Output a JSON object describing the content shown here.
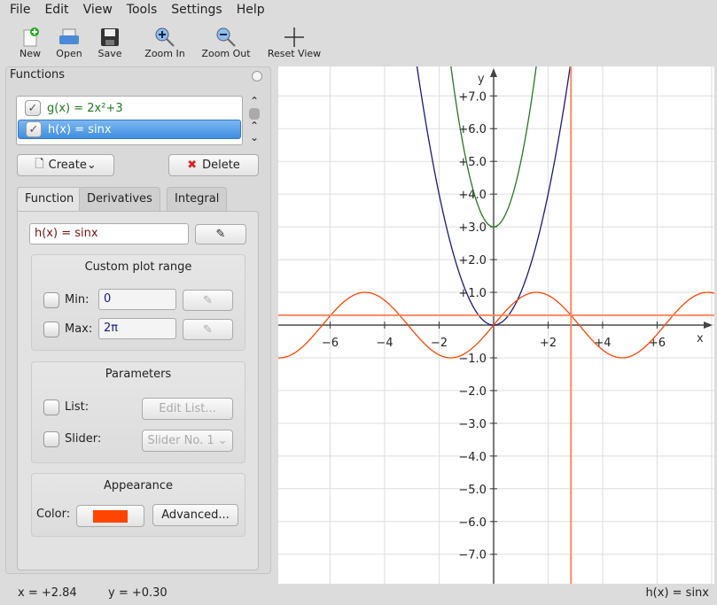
{
  "menu": [
    "File",
    "Edit",
    "View",
    "Tools",
    "Settings",
    "Help"
  ],
  "toolbar": {
    "new": "New",
    "open": "Open",
    "save": "Save",
    "zoom_in": "Zoom In",
    "zoom_out": "Zoom Out",
    "reset_view": "Reset View"
  },
  "functions_panel": {
    "title": "Functions",
    "items": [
      {
        "label": "g(x) = 2x²+3",
        "checked": true,
        "color": "#1f7a1f"
      },
      {
        "label": "h(x) = sinx",
        "checked": true,
        "selected": true
      }
    ],
    "create": "Create",
    "delete": "Delete"
  },
  "tabs": [
    "Function",
    "Derivatives",
    "Integral"
  ],
  "editor": {
    "equation_name": "h(x) = ",
    "equation_body": "sinx",
    "custom_range": {
      "title": "Custom plot range",
      "min_label": "Min:",
      "min_value": "0",
      "max_label": "Max:",
      "max_value": "2π",
      "min_checked": false,
      "max_checked": false
    },
    "parameters": {
      "title": "Parameters",
      "list_label": "List:",
      "edit_list": "Edit List...",
      "slider_label": "Slider:",
      "slider_value": "Slider No. 1"
    },
    "appearance": {
      "title": "Appearance",
      "color_label": "Color:",
      "color": "#ff4500",
      "advanced": "Advanced..."
    }
  },
  "status": {
    "x": "x = +2.84",
    "y": "y = +0.30",
    "function": "h(x) = sinx"
  },
  "plot": {
    "x_label": "x",
    "y_label": "y",
    "xlim": [
      -7.9,
      8.1
    ],
    "ylim": [
      -7.9,
      7.9
    ],
    "x_ticks": [
      "−6",
      "−4",
      "−2",
      "+2",
      "+4",
      "+6"
    ],
    "x_tick_values": [
      -6,
      -4,
      -2,
      2,
      4,
      6
    ],
    "y_ticks": [
      "+7.0",
      "+6.0",
      "+5.0",
      "+4.0",
      "+3.0",
      "+2.0",
      "+1.0",
      "−1.0",
      "−2.0",
      "−3.0",
      "−4.0",
      "−5.0",
      "−6.0",
      "−7.0"
    ],
    "y_tick_values": [
      7,
      6,
      5,
      4,
      3,
      2,
      1,
      -1,
      -2,
      -3,
      -4,
      -5,
      -6,
      -7
    ],
    "curves": [
      {
        "expr": "x^2",
        "color": "#1a1a7a"
      },
      {
        "expr": "2x^2+3",
        "color": "#1f7a1f"
      },
      {
        "expr": "sin(x)",
        "color": "#ff4500"
      }
    ],
    "crosshair": {
      "x": 2.84,
      "y": 0.3,
      "color": "#ff8a60"
    }
  }
}
